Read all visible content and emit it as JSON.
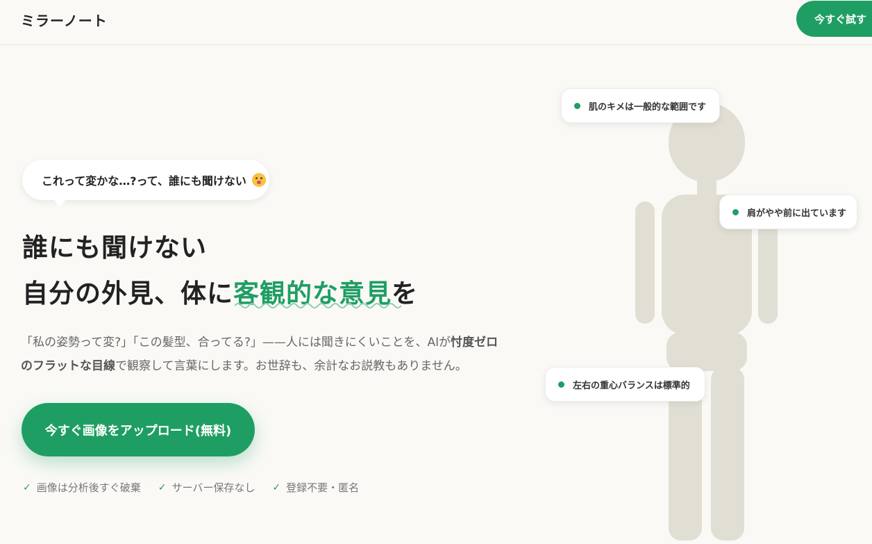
{
  "header": {
    "logo": "ミラーノート",
    "cta_label": "今すぐ試す"
  },
  "hero": {
    "speech_bubble": "これって変かな…?って、誰にも聞けない",
    "emoji_icon": "flushed-face-emoji",
    "headline_line1": "誰にも聞けない",
    "headline_line2_prefix": "自分の外見、体に",
    "headline_line2_accent": "客観的な意見",
    "headline_line2_suffix": "を",
    "description": {
      "part1": "「私の姿勢って変?」「この髪型、合ってる?」——人には聞きにくいことを、AIが",
      "bold1": "忖度ゼロのフラットな目線",
      "part2": "で観察して言葉にします。お世辞も、余計なお説教もありません。"
    },
    "cta_label": "今すぐ画像をアップロード(無料)",
    "features": [
      {
        "check_icon": "checkmark-icon",
        "label": "画像は分析後すぐ破棄"
      },
      {
        "check_icon": "checkmark-icon",
        "label": "サーバー保存なし"
      },
      {
        "check_icon": "checkmark-icon",
        "label": "登録不要・匿名"
      }
    ]
  },
  "figure": {
    "callouts": [
      {
        "label": "肌のキメは一般的な範囲です"
      },
      {
        "label": "肩がやや前に出ています"
      },
      {
        "label": "左右の重心バランスは標準的"
      }
    ]
  },
  "colors": {
    "accent": "#1f9e64",
    "background": "#faf9f6",
    "figure": "#e1dfd3"
  }
}
